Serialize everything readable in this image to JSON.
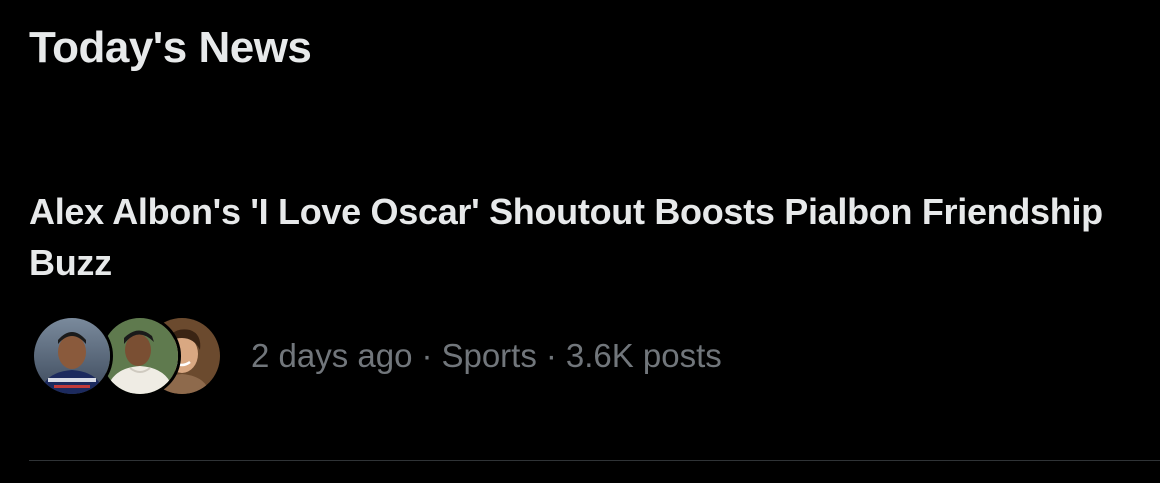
{
  "section": {
    "title": "Today's News"
  },
  "news_item": {
    "headline": "Alex Albon's 'I Love Oscar' Shoutout Boosts Pialbon Friendship Buzz",
    "time_ago": "2 days ago",
    "separator": "·",
    "category": "Sports",
    "post_count": "3.6K posts",
    "avatars": [
      {
        "icon": "driver-portrait-avatar"
      },
      {
        "icon": "person-hoodie-avatar"
      },
      {
        "icon": "smiling-person-avatar"
      }
    ]
  },
  "colors": {
    "background": "#000000",
    "primary_text": "#e7e9ea",
    "secondary_text": "#71767b",
    "divider": "#2f3336"
  }
}
